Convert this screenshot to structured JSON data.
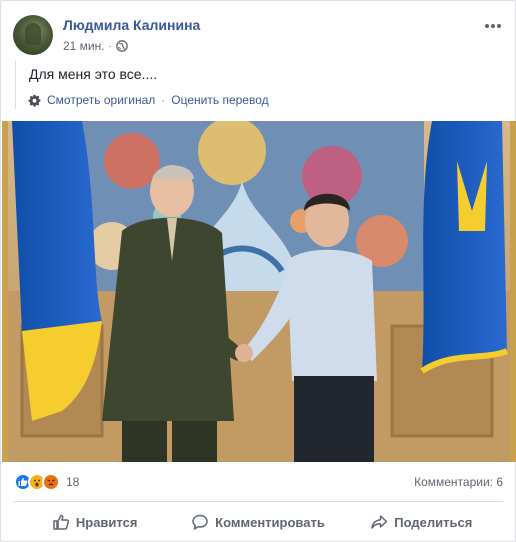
{
  "post": {
    "author": "Людмила Калинина",
    "time": "21 мин.",
    "text": "Для меня это все....",
    "translation": {
      "see_original": "Смотреть оригинал",
      "rate_translation": "Оценить перевод"
    }
  },
  "stats": {
    "reaction_count": "18",
    "comments": "Комментарии: 6"
  },
  "actions": {
    "like": "Нравится",
    "comment": "Комментировать",
    "share": "Поделиться"
  },
  "icons": [
    "globe-icon",
    "more-icon",
    "gear-icon",
    "like-icon",
    "comment-icon",
    "share-icon"
  ],
  "colors": {
    "link": "#385898",
    "secondary_text": "#606770",
    "like_reaction": "#1877f2",
    "wow_reaction": "#f7b125",
    "angry_reaction": "#e9710f"
  }
}
